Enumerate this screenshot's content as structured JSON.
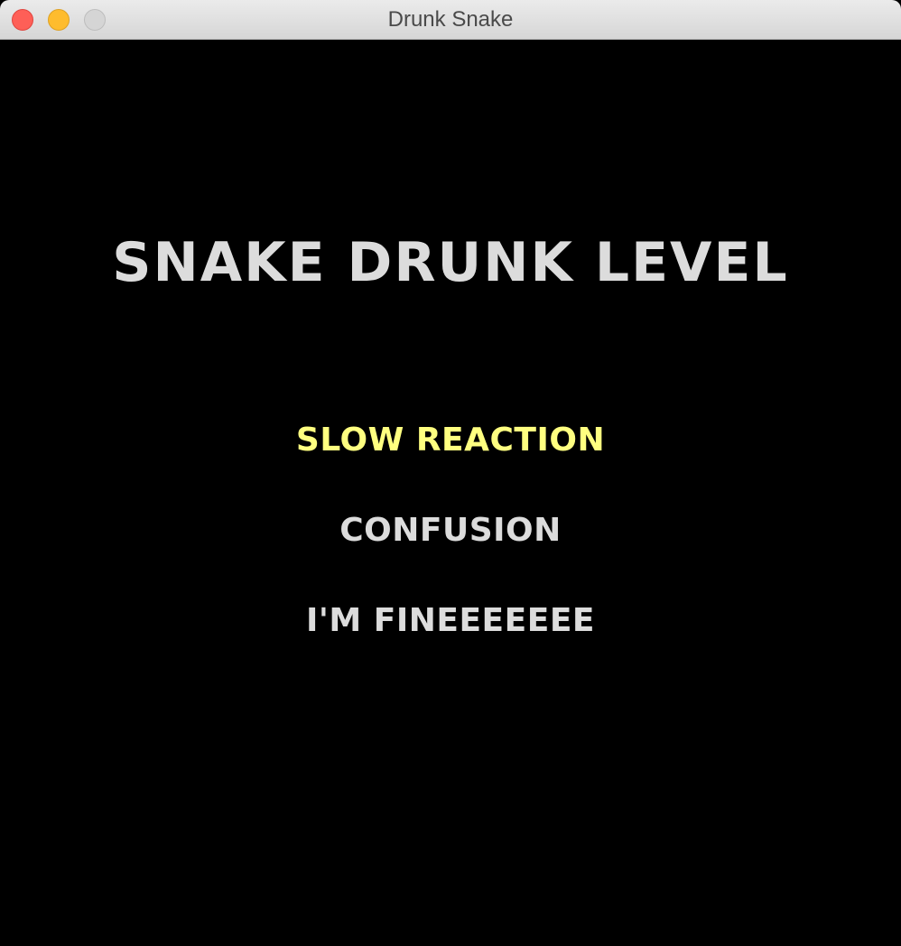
{
  "window": {
    "title": "Drunk Snake"
  },
  "menu": {
    "heading": "SNAKE DRUNK LEVEL",
    "options": [
      {
        "label": "SLOW REACTION",
        "selected": true
      },
      {
        "label": "CONFUSION",
        "selected": false
      },
      {
        "label": "I'M FINEEEEEEE",
        "selected": false
      }
    ]
  },
  "colors": {
    "background": "#000000",
    "text": "#dcdcdc",
    "selected": "#ffff80"
  }
}
